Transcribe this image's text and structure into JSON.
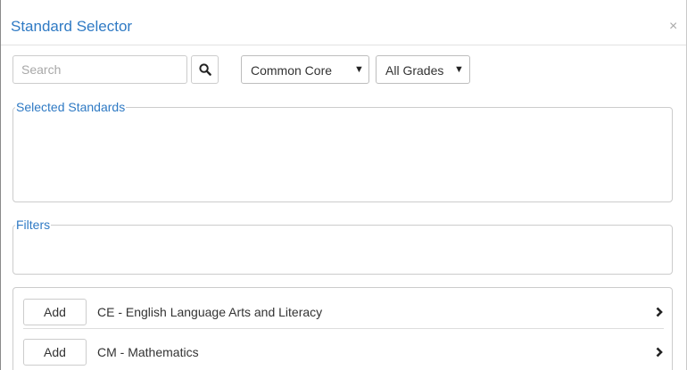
{
  "dialog": {
    "title": "Standard Selector",
    "close_symbol": "×"
  },
  "search": {
    "placeholder": "Search",
    "value": "",
    "icon": "search-icon"
  },
  "framework_select": {
    "value": "Common Core",
    "caret": "▼"
  },
  "grade_select": {
    "value": "All Grades",
    "caret": "▼"
  },
  "selected_standards": {
    "legend": "Selected Standards"
  },
  "filters": {
    "legend": "Filters"
  },
  "results": [
    {
      "add_label": "Add",
      "label": "CE - English Language Arts and Literacy",
      "icon": "chevron-right-icon"
    },
    {
      "add_label": "Add",
      "label": "CM - Mathematics",
      "icon": "chevron-right-icon"
    }
  ],
  "colors": {
    "accent": "#2f7ac4",
    "border": "#cccccc",
    "text": "#333333"
  }
}
